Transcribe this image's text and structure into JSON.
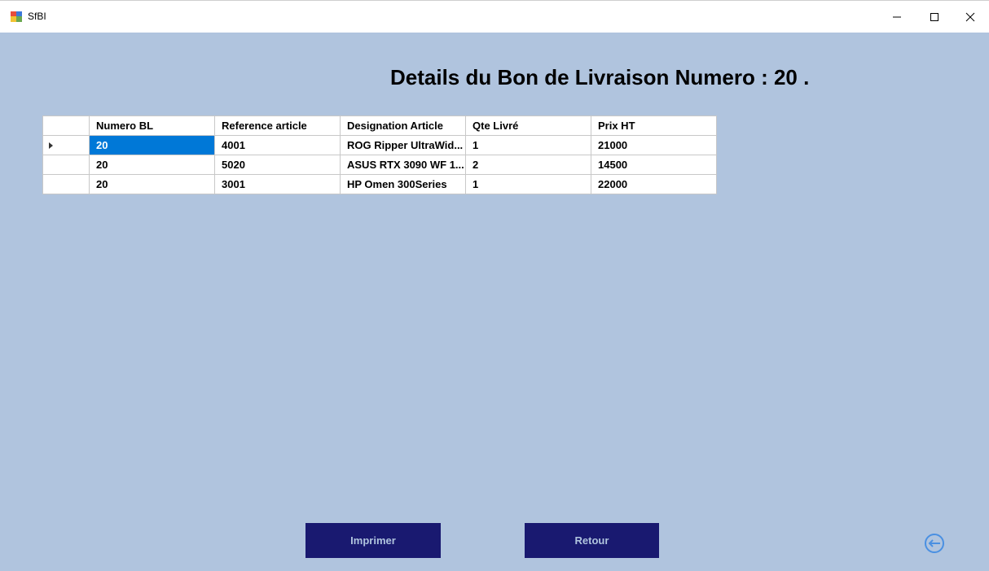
{
  "window": {
    "title": "SfBI",
    "minimize_icon": "minimize-icon",
    "maximize_icon": "maximize-icon",
    "close_icon": "close-icon"
  },
  "heading": "Details du Bon de Livraison Numero : 20 .",
  "grid": {
    "columns": [
      "Numero BL",
      "Reference article",
      "Designation Article",
      "Qte Livré",
      "Prix HT"
    ],
    "rows": [
      [
        "20",
        "4001",
        "ROG Ripper UltraWid...",
        "1",
        "21000"
      ],
      [
        "20",
        "5020",
        "ASUS RTX 3090 WF 1...",
        "2",
        "14500"
      ],
      [
        "20",
        "3001",
        "HP Omen 300Series",
        "1",
        "22000"
      ]
    ],
    "selected_row": 0,
    "selected_color": "#0078d7"
  },
  "buttons": {
    "print": "Imprimer",
    "back": "Retour"
  },
  "colors": {
    "background": "#b0c4de",
    "button": "#191970",
    "button_text": "#b0c4de",
    "exit_icon": "#4a90e2"
  },
  "exit_icon": "exit-arrow-icon"
}
